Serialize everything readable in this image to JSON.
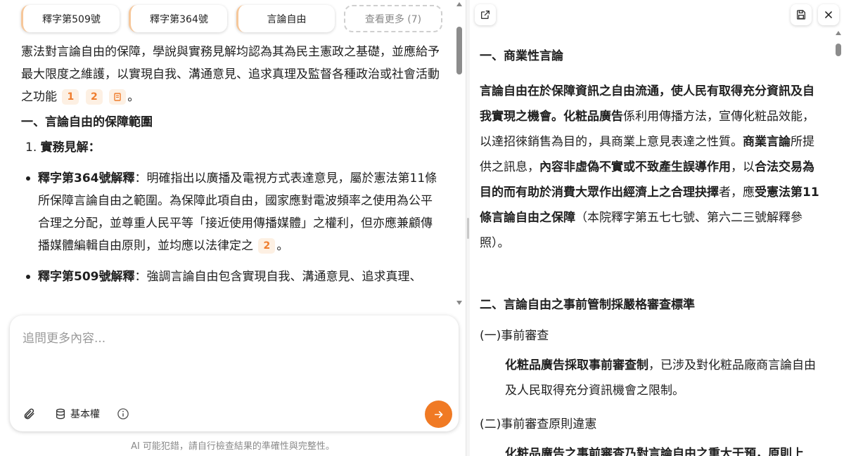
{
  "chips": [
    "釋字第509號",
    "釋字第364號",
    "言論自由"
  ],
  "chips_more": "查看更多 (7)",
  "answer": {
    "intro": "憲法對言論自由的保障，學說與實務見解均認為其為民主憲政之基礎，並應給予最大限度之維護，以實現自我、溝通意見、追求真理及監督各種政治或社會活動之功能",
    "intro_cites": [
      "1",
      "2"
    ],
    "intro_end": "。",
    "section_heading": "一、言論自由的保障範圍",
    "ol_number": "1.",
    "ol_label": "實務見解：",
    "bullet1_title": "釋字第364號解釋",
    "bullet1_text": "：明確指出以廣播及電視方式表達意見，屬於憲法第11條所保障言論自由之範圍。為保障此項自由，國家應對電波頻率之使用為公平合理之分配，並尊重人民平等「接近使用傳播媒體」之權利，但亦應兼顧傳播媒體編輯自由原則，並均應以法律定之",
    "bullet1_cite": "2",
    "bullet1_end": "。",
    "bullet2_title": "釋字第509號解釋",
    "bullet2_text": "：強調言論自由包含實現自我、溝通意見、追求真理、"
  },
  "input": {
    "placeholder": "追問更多內容...",
    "kb_label": "基本權"
  },
  "disclaimer": "AI 可能犯錯，請自行檢查結果的準確性與完整性。",
  "doc": {
    "h1": "一、商業性言論",
    "p1_b1": "言論自由在於保障資訊之自由流通，使人民有取得充分資訊及自我實現之機會。",
    "p1_b2": "化粧品廣告",
    "p1_t1": "係利用傳播方法，宣傳化粧品效能，以達招徠銷售為目的，具商業上意見表達之性質。",
    "p1_b3": "商業言論",
    "p1_t2": "所提供之訊息，",
    "p1_b4": "內容非虛偽不實或不致產生誤導作用",
    "p1_t3": "，以",
    "p1_b5": "合法交易為目的而有助於消費大眾作出經濟上之合理抉擇",
    "p1_t4": "者，應",
    "p1_b6": "受憲法第11條言論自由之保障",
    "p1_t5": "（本院釋字第五七七號、第六二三號解釋參照）。",
    "h2": "二、言論自由之事前管制採嚴格審查標準",
    "sub1": "(一)事前審查",
    "sub1_b": "化粧品廣告採取事前審查制",
    "sub1_t": "，已涉及對化粧品廠商言論自由及人民取得充分資訊機會之限制。",
    "sub2": "(二)事前審查原則違憲",
    "sub2_b": "化粧品廣告之事前審查乃對言論自由之重大干預，原則上"
  },
  "colors": {
    "accent": "#f07a24",
    "cite_bg": "#fdf0e3",
    "cite_text": "#ef7d2d"
  }
}
